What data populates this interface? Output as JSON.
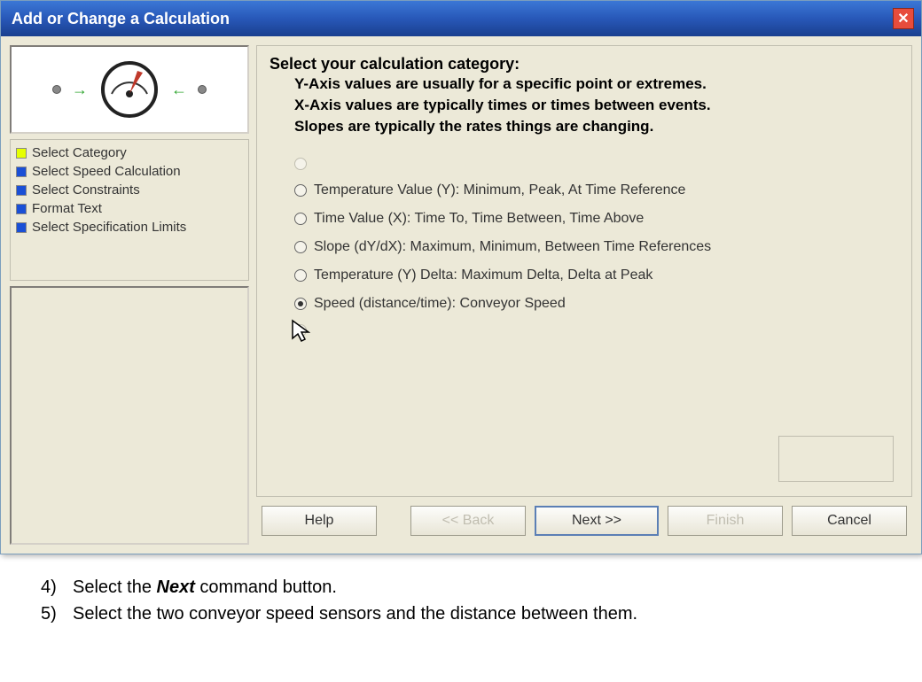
{
  "titlebar": {
    "title": "Add or Change a Calculation"
  },
  "steps": [
    {
      "label": "Select Category",
      "color": "yellow"
    },
    {
      "label": "Select Speed Calculation",
      "color": "blue"
    },
    {
      "label": "Select Constraints",
      "color": "blue"
    },
    {
      "label": "Format Text",
      "color": "blue"
    },
    {
      "label": "Select Specification Limits",
      "color": "blue"
    }
  ],
  "content": {
    "heading": "Select your calculation category:",
    "sublines": [
      "Y-Axis values are usually for a specific point or extremes.",
      "X-Axis values are typically times or times between events.",
      "Slopes are typically the rates things are changing."
    ],
    "options": [
      {
        "label": "",
        "selected": false,
        "disabled": true
      },
      {
        "label": "Temperature Value (Y):  Minimum, Peak, At Time Reference",
        "selected": false,
        "disabled": false
      },
      {
        "label": "Time Value (X):  Time To, Time Between, Time Above",
        "selected": false,
        "disabled": false
      },
      {
        "label": "Slope (dY/dX):  Maximum, Minimum, Between Time References",
        "selected": false,
        "disabled": false
      },
      {
        "label": "Temperature (Y) Delta:  Maximum Delta, Delta at Peak",
        "selected": false,
        "disabled": false
      },
      {
        "label": "Speed (distance/time): Conveyor Speed",
        "selected": true,
        "disabled": false
      },
      {
        "label": "",
        "selected": false,
        "disabled": true
      }
    ]
  },
  "buttons": {
    "help": "Help",
    "back": "<< Back",
    "next": "Next >>",
    "finish": "Finish",
    "cancel": "Cancel"
  },
  "instructions": {
    "items": [
      {
        "num": "4)",
        "textBefore": "Select the ",
        "bold": "Next",
        "textAfter": " command button."
      },
      {
        "num": "5)",
        "textBefore": "Select the two conveyor speed sensors and the distance between them.",
        "bold": "",
        "textAfter": ""
      }
    ]
  }
}
